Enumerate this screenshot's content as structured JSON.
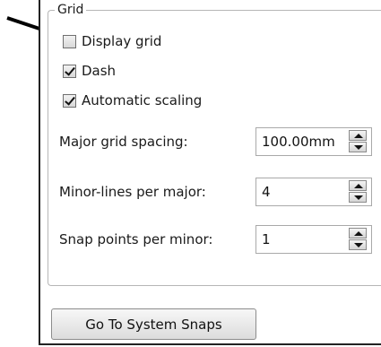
{
  "group": {
    "title": "Grid"
  },
  "checkboxes": [
    {
      "label": "Display grid",
      "checked": false
    },
    {
      "label": "Dash",
      "checked": true
    },
    {
      "label": "Automatic scaling",
      "checked": true
    }
  ],
  "fields": [
    {
      "label": "Major grid spacing:",
      "value": "100.00mm"
    },
    {
      "label": "Minor-lines per major:",
      "value": "4"
    },
    {
      "label": "Snap points per minor:",
      "value": "1"
    }
  ],
  "buttons": {
    "system_snaps": "Go To System Snaps"
  },
  "colors": {
    "border": "#b6b6b6",
    "frame": "#222222",
    "arrow": "#000000"
  }
}
